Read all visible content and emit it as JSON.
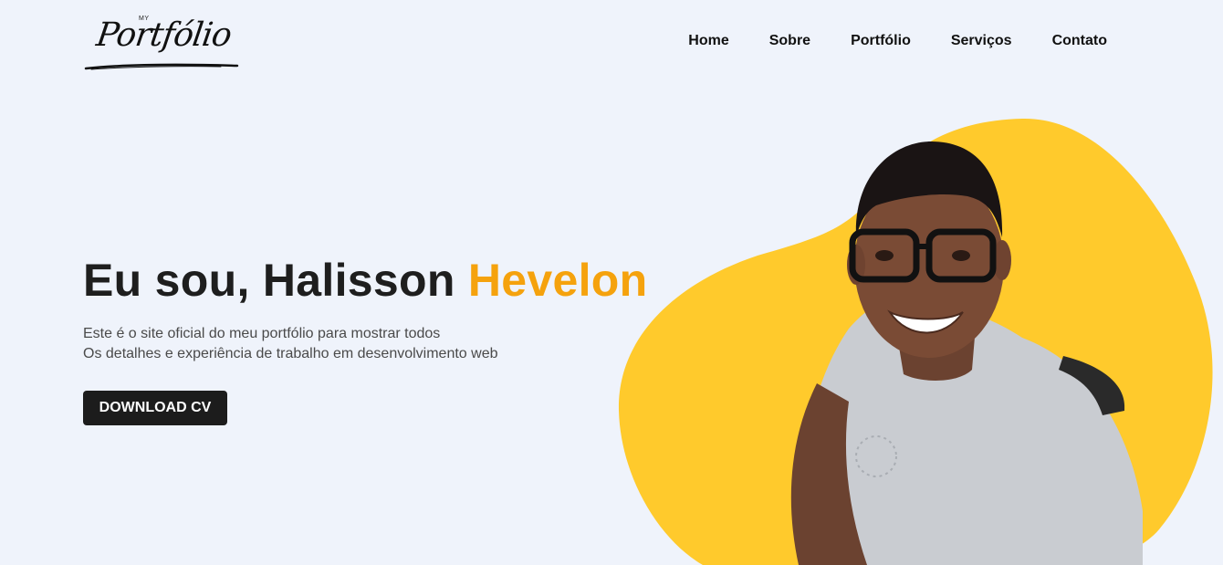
{
  "logo": {
    "small": "MY",
    "script": "Portfólio"
  },
  "nav": {
    "items": [
      {
        "label": "Home"
      },
      {
        "label": "Sobre"
      },
      {
        "label": "Portfólio"
      },
      {
        "label": "Serviços"
      },
      {
        "label": "Contato"
      }
    ]
  },
  "hero": {
    "title_prefix": "Eu sou, Halisson ",
    "title_accent": "Hevelon",
    "desc_line1": "Este é o site oficial do meu portfólio para mostrar todos",
    "desc_line2": "Os detalhes e experiência de trabalho em desenvolvimento web",
    "cta_label": "DOWNLOAD CV"
  },
  "colors": {
    "background": "#eff3fb",
    "accent": "#f5a20d",
    "blob": "#ffca2c",
    "button": "#1c1c1c"
  }
}
